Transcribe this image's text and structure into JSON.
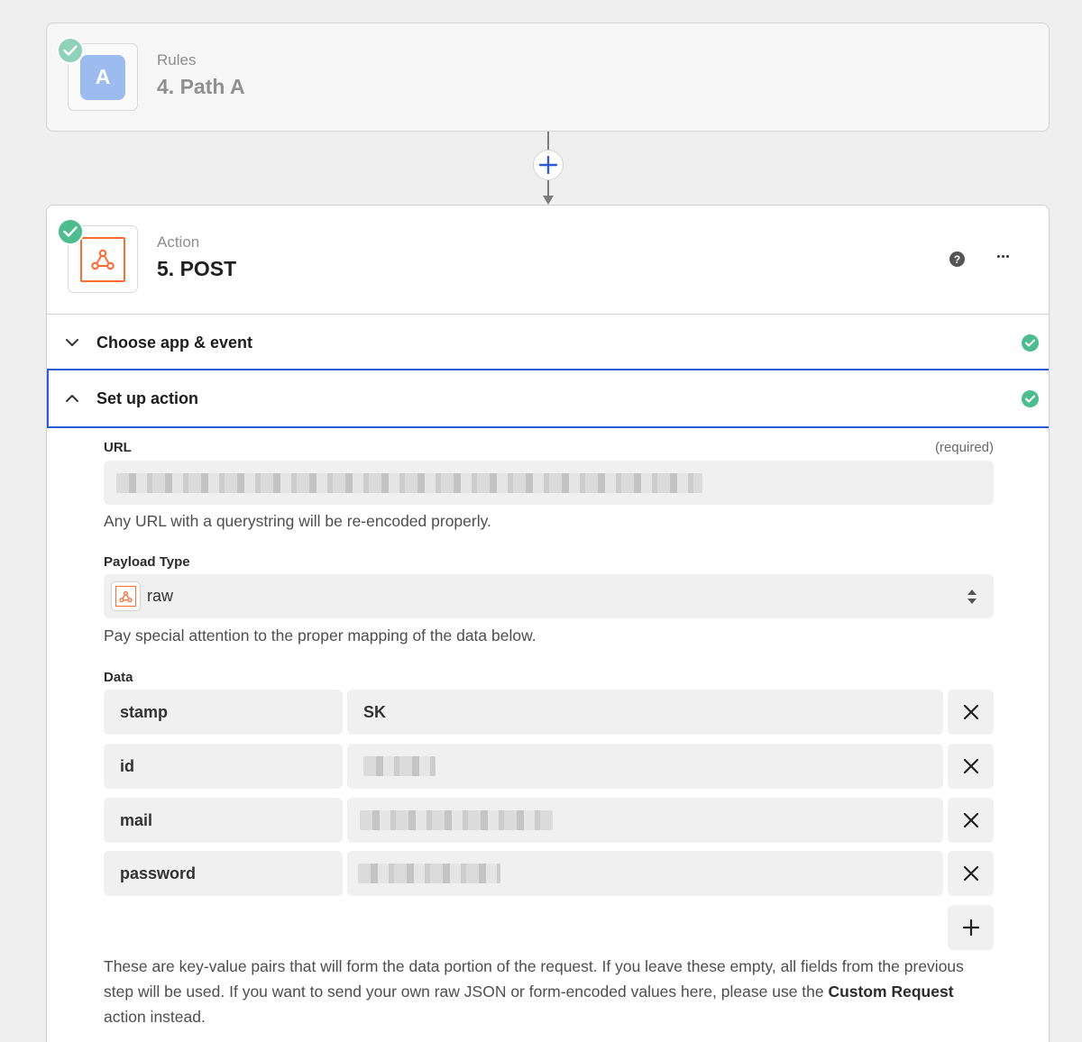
{
  "step4": {
    "app_letter": "A",
    "kind": "Rules",
    "title": "4. Path A"
  },
  "step5": {
    "kind": "Action",
    "title": "5. POST",
    "help_glyph": "?"
  },
  "sections": {
    "choose": "Choose app & event",
    "setup": "Set up action"
  },
  "url_field": {
    "label": "URL",
    "required": "(required)",
    "value_redacted": true,
    "help": "Any URL with a querystring will be re-encoded properly."
  },
  "payload_field": {
    "label": "Payload Type",
    "value": "raw",
    "help": "Pay special attention to the proper mapping of the data below."
  },
  "data_field": {
    "label": "Data",
    "rows": [
      {
        "key": "stamp",
        "value": "SK"
      },
      {
        "key": "id",
        "value": ""
      },
      {
        "key": "mail",
        "value": ""
      },
      {
        "key": "password",
        "value": ""
      }
    ],
    "help_part1": "These are key-value pairs that will form the data portion of the request. If you leave these empty, all fields from the previous step will be used. If you want to send your own raw JSON or form-encoded values here, please use the ",
    "help_bold": "Custom Request",
    "help_part2": " action instead."
  },
  "colors": {
    "accent_blue": "#2c5ad8",
    "success_green": "#4dbc8f",
    "webhook_orange": "#ff6a35"
  },
  "icons": [
    "check-icon",
    "letter-a-icon",
    "plus-icon",
    "webhook-icon",
    "help-icon",
    "more-icon",
    "chevron-down-icon",
    "chevron-up-icon",
    "select-arrows-icon",
    "close-icon"
  ]
}
